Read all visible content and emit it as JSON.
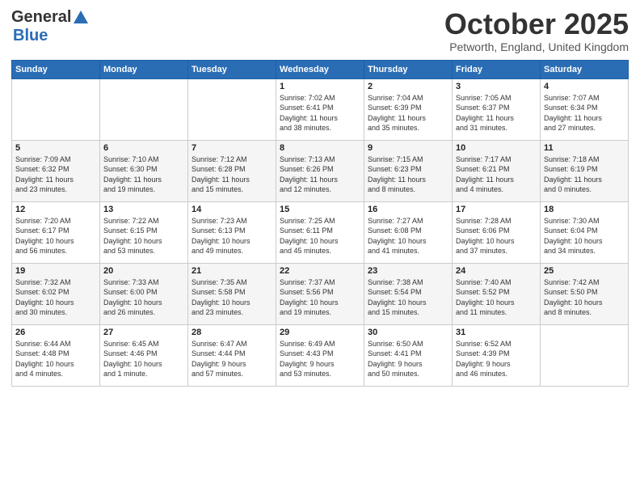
{
  "logo": {
    "general": "General",
    "blue": "Blue"
  },
  "title": "October 2025",
  "location": "Petworth, England, United Kingdom",
  "weekdays": [
    "Sunday",
    "Monday",
    "Tuesday",
    "Wednesday",
    "Thursday",
    "Friday",
    "Saturday"
  ],
  "weeks": [
    [
      {
        "day": "",
        "info": ""
      },
      {
        "day": "",
        "info": ""
      },
      {
        "day": "",
        "info": ""
      },
      {
        "day": "1",
        "info": "Sunrise: 7:02 AM\nSunset: 6:41 PM\nDaylight: 11 hours\nand 38 minutes."
      },
      {
        "day": "2",
        "info": "Sunrise: 7:04 AM\nSunset: 6:39 PM\nDaylight: 11 hours\nand 35 minutes."
      },
      {
        "day": "3",
        "info": "Sunrise: 7:05 AM\nSunset: 6:37 PM\nDaylight: 11 hours\nand 31 minutes."
      },
      {
        "day": "4",
        "info": "Sunrise: 7:07 AM\nSunset: 6:34 PM\nDaylight: 11 hours\nand 27 minutes."
      }
    ],
    [
      {
        "day": "5",
        "info": "Sunrise: 7:09 AM\nSunset: 6:32 PM\nDaylight: 11 hours\nand 23 minutes."
      },
      {
        "day": "6",
        "info": "Sunrise: 7:10 AM\nSunset: 6:30 PM\nDaylight: 11 hours\nand 19 minutes."
      },
      {
        "day": "7",
        "info": "Sunrise: 7:12 AM\nSunset: 6:28 PM\nDaylight: 11 hours\nand 15 minutes."
      },
      {
        "day": "8",
        "info": "Sunrise: 7:13 AM\nSunset: 6:26 PM\nDaylight: 11 hours\nand 12 minutes."
      },
      {
        "day": "9",
        "info": "Sunrise: 7:15 AM\nSunset: 6:23 PM\nDaylight: 11 hours\nand 8 minutes."
      },
      {
        "day": "10",
        "info": "Sunrise: 7:17 AM\nSunset: 6:21 PM\nDaylight: 11 hours\nand 4 minutes."
      },
      {
        "day": "11",
        "info": "Sunrise: 7:18 AM\nSunset: 6:19 PM\nDaylight: 11 hours\nand 0 minutes."
      }
    ],
    [
      {
        "day": "12",
        "info": "Sunrise: 7:20 AM\nSunset: 6:17 PM\nDaylight: 10 hours\nand 56 minutes."
      },
      {
        "day": "13",
        "info": "Sunrise: 7:22 AM\nSunset: 6:15 PM\nDaylight: 10 hours\nand 53 minutes."
      },
      {
        "day": "14",
        "info": "Sunrise: 7:23 AM\nSunset: 6:13 PM\nDaylight: 10 hours\nand 49 minutes."
      },
      {
        "day": "15",
        "info": "Sunrise: 7:25 AM\nSunset: 6:11 PM\nDaylight: 10 hours\nand 45 minutes."
      },
      {
        "day": "16",
        "info": "Sunrise: 7:27 AM\nSunset: 6:08 PM\nDaylight: 10 hours\nand 41 minutes."
      },
      {
        "day": "17",
        "info": "Sunrise: 7:28 AM\nSunset: 6:06 PM\nDaylight: 10 hours\nand 37 minutes."
      },
      {
        "day": "18",
        "info": "Sunrise: 7:30 AM\nSunset: 6:04 PM\nDaylight: 10 hours\nand 34 minutes."
      }
    ],
    [
      {
        "day": "19",
        "info": "Sunrise: 7:32 AM\nSunset: 6:02 PM\nDaylight: 10 hours\nand 30 minutes."
      },
      {
        "day": "20",
        "info": "Sunrise: 7:33 AM\nSunset: 6:00 PM\nDaylight: 10 hours\nand 26 minutes."
      },
      {
        "day": "21",
        "info": "Sunrise: 7:35 AM\nSunset: 5:58 PM\nDaylight: 10 hours\nand 23 minutes."
      },
      {
        "day": "22",
        "info": "Sunrise: 7:37 AM\nSunset: 5:56 PM\nDaylight: 10 hours\nand 19 minutes."
      },
      {
        "day": "23",
        "info": "Sunrise: 7:38 AM\nSunset: 5:54 PM\nDaylight: 10 hours\nand 15 minutes."
      },
      {
        "day": "24",
        "info": "Sunrise: 7:40 AM\nSunset: 5:52 PM\nDaylight: 10 hours\nand 11 minutes."
      },
      {
        "day": "25",
        "info": "Sunrise: 7:42 AM\nSunset: 5:50 PM\nDaylight: 10 hours\nand 8 minutes."
      }
    ],
    [
      {
        "day": "26",
        "info": "Sunrise: 6:44 AM\nSunset: 4:48 PM\nDaylight: 10 hours\nand 4 minutes."
      },
      {
        "day": "27",
        "info": "Sunrise: 6:45 AM\nSunset: 4:46 PM\nDaylight: 10 hours\nand 1 minute."
      },
      {
        "day": "28",
        "info": "Sunrise: 6:47 AM\nSunset: 4:44 PM\nDaylight: 9 hours\nand 57 minutes."
      },
      {
        "day": "29",
        "info": "Sunrise: 6:49 AM\nSunset: 4:43 PM\nDaylight: 9 hours\nand 53 minutes."
      },
      {
        "day": "30",
        "info": "Sunrise: 6:50 AM\nSunset: 4:41 PM\nDaylight: 9 hours\nand 50 minutes."
      },
      {
        "day": "31",
        "info": "Sunrise: 6:52 AM\nSunset: 4:39 PM\nDaylight: 9 hours\nand 46 minutes."
      },
      {
        "day": "",
        "info": ""
      }
    ]
  ]
}
